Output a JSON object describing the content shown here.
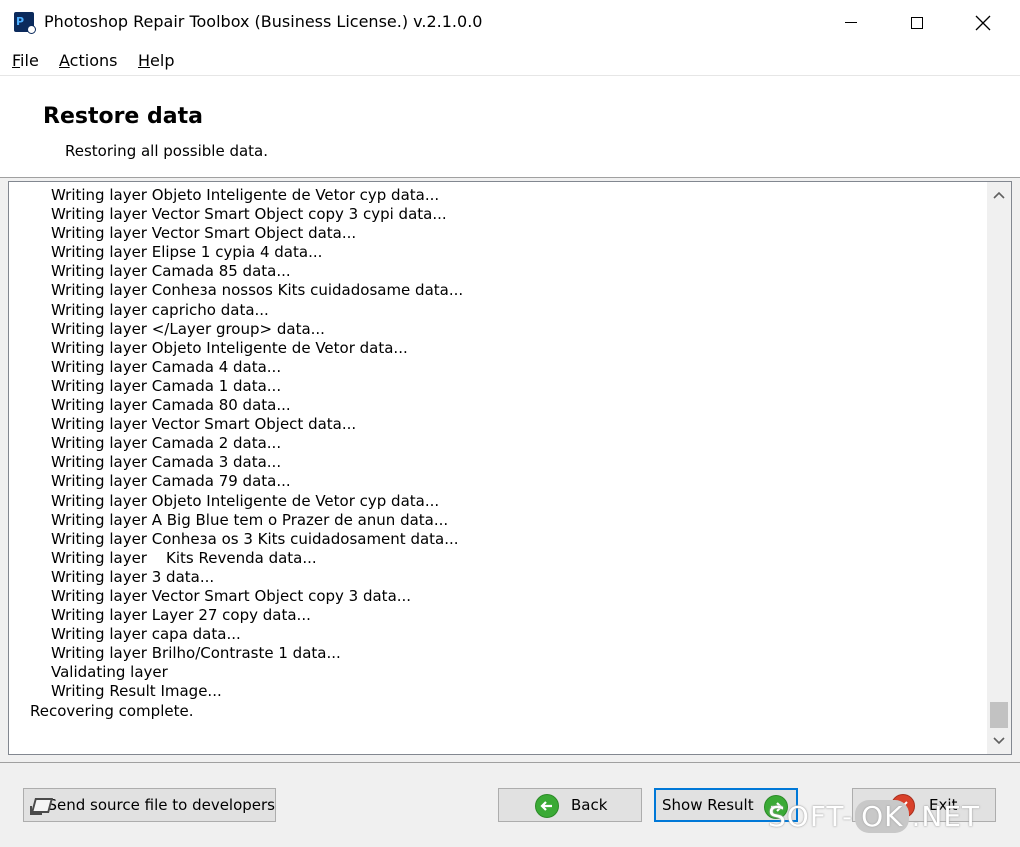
{
  "window": {
    "title": "Photoshop Repair Toolbox (Business License.) v.2.1.0.0",
    "app_icon_label": "P"
  },
  "menu": [
    {
      "accel": "F",
      "rest": "ile"
    },
    {
      "accel": "A",
      "rest": "ctions"
    },
    {
      "accel": "H",
      "rest": "elp"
    }
  ],
  "header": {
    "title": "Restore data",
    "subtitle": "Restoring all possible data."
  },
  "log": {
    "lines": [
      "Writing layer Objeto Inteligente de Vetor cyp data...",
      "Writing layer Vector Smart Object copy 3 cypi data...",
      "Writing layer Vector Smart Object data...",
      "Writing layer Elipse 1 cypia 4 data...",
      "Writing layer Camada 85 data...",
      "Writing layer Conheзa nossos Kits cuidadosame data...",
      "Writing layer capricho data...",
      "Writing layer </Layer group> data...",
      "Writing layer Objeto Inteligente de Vetor data...",
      "Writing layer Camada 4 data...",
      "Writing layer Camada 1 data...",
      "Writing layer Camada 80 data...",
      "Writing layer Vector Smart Object data...",
      "Writing layer Camada 2 data...",
      "Writing layer Camada 3 data...",
      "Writing layer Camada 79 data...",
      "Writing layer Objeto Inteligente de Vetor cyp data...",
      "Writing layer A Big Blue tem o Prazer de anun data...",
      "Writing layer Conheзa os 3 Kits cuidadosament data...",
      "Writing layer    Kits Revenda data...",
      "Writing layer 3 data...",
      "Writing layer Vector Smart Object copy 3 data...",
      "Writing layer Layer 27 copy data...",
      "Writing layer capa data...",
      "Writing layer Brilho/Contraste 1 data...",
      "Validating layer",
      "Writing Result Image..."
    ],
    "final_line": "Recovering complete."
  },
  "buttons": {
    "send": "Send source file to developers",
    "back": "Back",
    "show_result": "Show Result",
    "exit": "Exit"
  },
  "watermark": {
    "left": "SOFT-",
    "mid": "OK",
    "right": ".NET"
  },
  "colors": {
    "focus_border": "#0078d7",
    "back_icon": "#3aaa35",
    "exit_icon": "#d9412b"
  }
}
